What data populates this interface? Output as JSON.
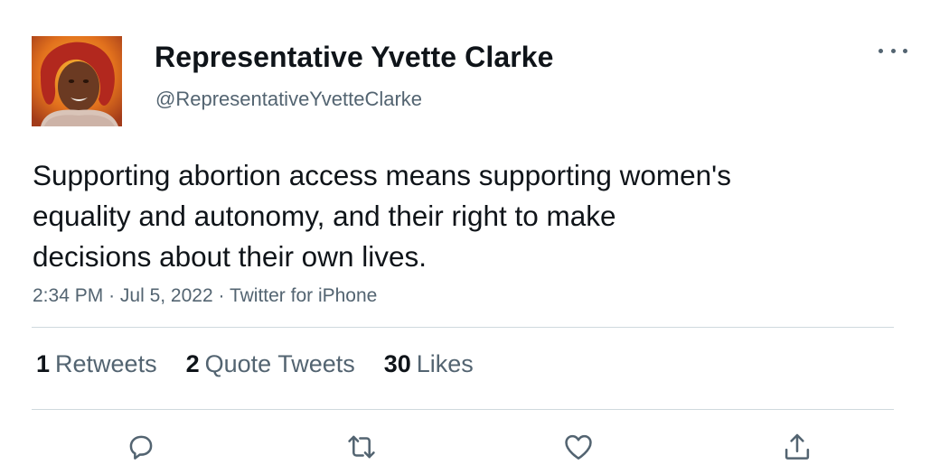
{
  "author": {
    "display_name": "Representative Yvette Clarke",
    "handle": "@RepresentativeYvetteClarke"
  },
  "tweet": {
    "text_lines": [
      "Supporting abortion access means supporting women's",
      "equality and autonomy, and their right to make",
      "decisions about their own lives."
    ],
    "time": "2:34 PM",
    "date": "Jul 5, 2022",
    "source": "Twitter for iPhone",
    "separator": "·"
  },
  "stats": {
    "retweets_count": "1",
    "retweets_label": "Retweets",
    "quotes_count": "2",
    "quotes_label": "Quote Tweets",
    "likes_count": "30",
    "likes_label": "Likes"
  },
  "icons": {
    "more": "more-horizontal-icon",
    "reply": "reply-icon",
    "retweet": "retweet-icon",
    "like": "heart-icon",
    "share": "share-icon"
  },
  "colors": {
    "text_primary": "#0f1419",
    "text_secondary": "#536471",
    "divider": "#cfd9de"
  }
}
